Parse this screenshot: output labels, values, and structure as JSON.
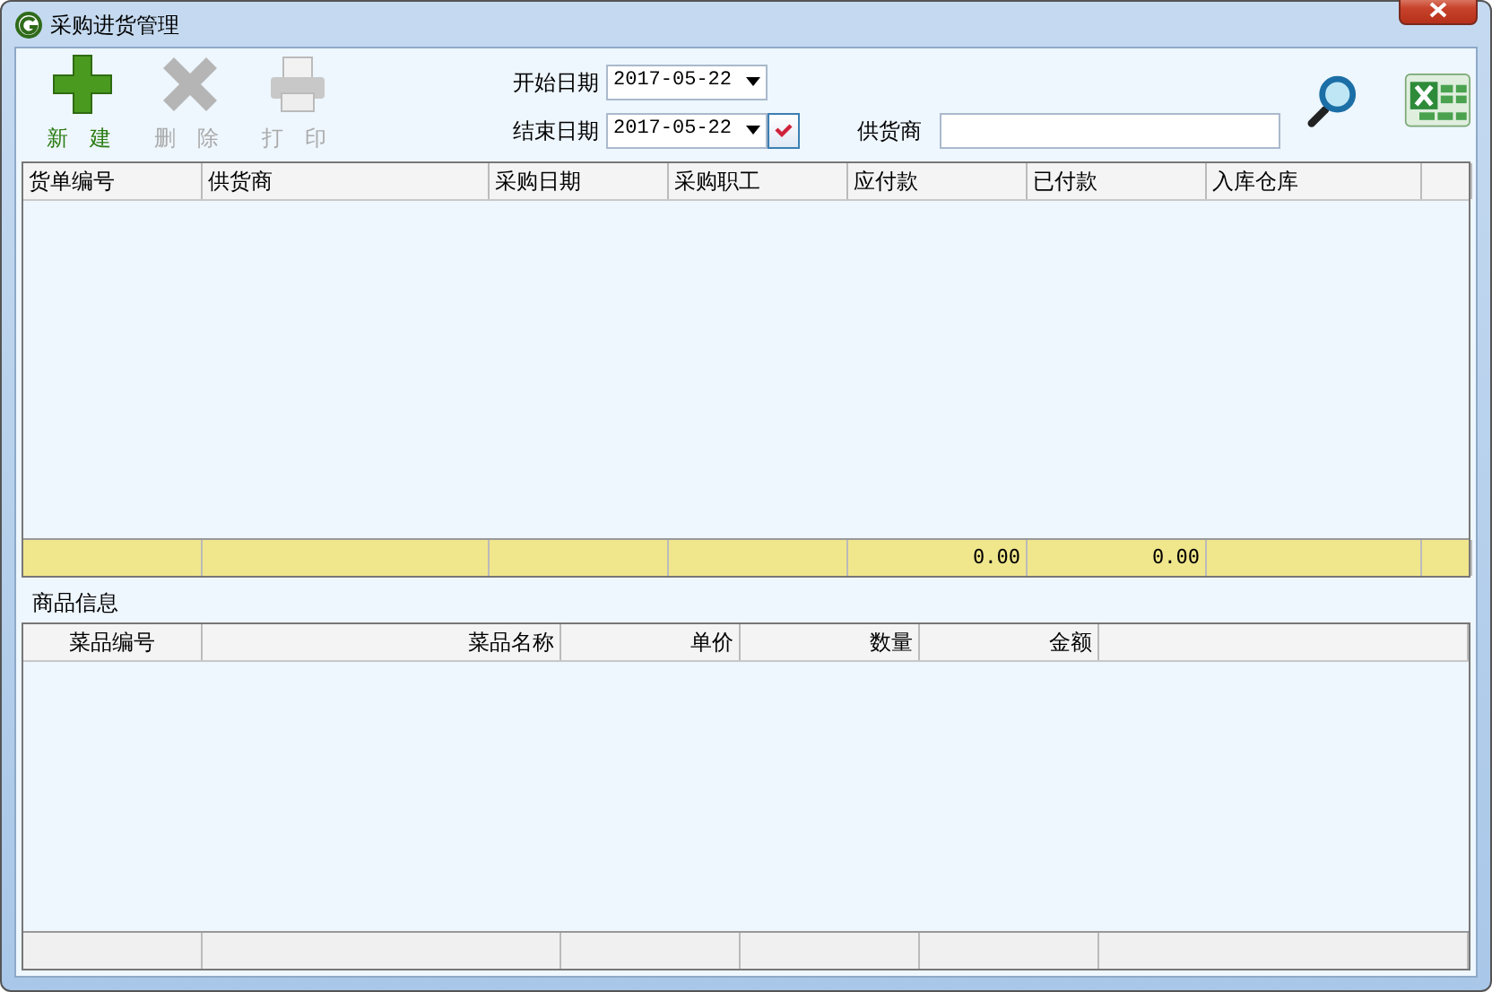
{
  "window": {
    "title": "采购进货管理"
  },
  "toolbar": [
    {
      "label": "新 建",
      "kind": "add",
      "disabled": false
    },
    {
      "label": "删 除",
      "kind": "delete",
      "disabled": true
    },
    {
      "label": "打 印",
      "kind": "print",
      "disabled": true
    }
  ],
  "filters": {
    "start_date": {
      "label": "开始日期",
      "value": "2017-05-22"
    },
    "end_date": {
      "label": "结束日期",
      "value": "2017-05-22",
      "checked": true
    },
    "supplier": {
      "label": "供货商"
    }
  },
  "orders_table": {
    "columns": [
      "货单编号",
      "供货商",
      "采购日期",
      "采购职工",
      "应付款",
      "已付款",
      "入库仓库"
    ],
    "totals": {
      "payable": "0.00",
      "paid": "0.00"
    }
  },
  "goods_section": {
    "title": "商品信息",
    "columns": [
      "菜品编号",
      "菜品名称",
      "单价",
      "数量",
      "金额"
    ]
  }
}
